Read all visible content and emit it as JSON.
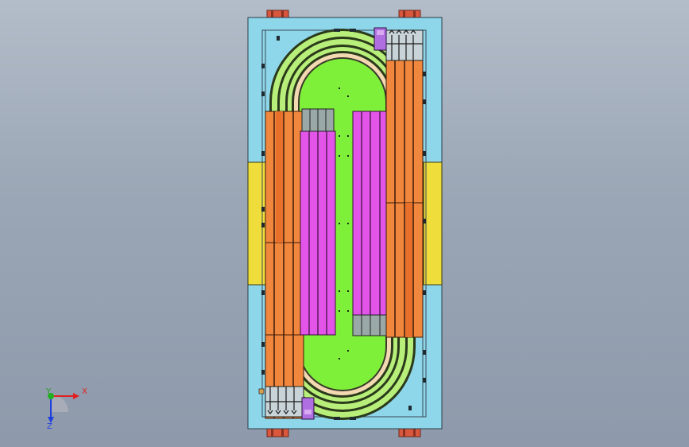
{
  "triad": {
    "x_label": "X",
    "y_label": "Y",
    "z_label": "Z"
  },
  "colors": {
    "background_top": "#b3bcc9",
    "background_bottom": "#8e9aab",
    "base_plate": "#8ed6ea",
    "side_bracket": "#efdd3c",
    "center_plate": "#7ff03a",
    "rail_green": "#b7ef7a",
    "rail_dark": "#2a3a1a",
    "conveyor_orange": "#f0873c",
    "conveyor_magenta": "#e255e8",
    "motor_purple": "#b06fe0",
    "foot_red": "#d9573d",
    "belt_tan": "#f2d9b2"
  },
  "icons": {
    "axis_triad": "xyz-axis-triad-icon"
  }
}
